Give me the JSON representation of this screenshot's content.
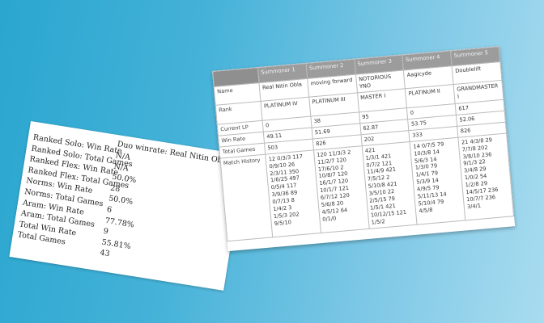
{
  "stats": {
    "duo": "Duo winrate: Real Nitin Obla",
    "rows": [
      {
        "label": "Ranked Solo: Win Rate",
        "value": "N/A"
      },
      {
        "label": "Ranked Solo: Total Games",
        "value": "N/A"
      },
      {
        "label": "Ranked Flex: Win Rate",
        "value": "50.0%"
      },
      {
        "label": "Ranked Flex: Total Games",
        "value": "28"
      },
      {
        "label": "Norms: Win Rate",
        "value": "50.0%"
      },
      {
        "label": "Norms: Total Games",
        "value": "6"
      },
      {
        "label": "Aram: Win Rate",
        "value": "77.78%"
      },
      {
        "label": "Aram: Total Games",
        "value": "9"
      },
      {
        "label": "Total Win Rate",
        "value": "55.81%"
      },
      {
        "label": "Total Games",
        "value": "43"
      }
    ]
  },
  "table": {
    "headers": [
      "Summoner 1",
      "Summoner 2",
      "Summoner 3",
      "Summoner 4",
      "Summoner 5"
    ],
    "row_labels": {
      "name": "Name",
      "rank": "Rank",
      "lp": "Current LP",
      "winrate": "Win Rate",
      "games": "Total Games",
      "history": "Match History"
    },
    "summoners": [
      {
        "name": "Real Nitin Obla",
        "rank": "PLATINUM IV",
        "lp": "0",
        "winrate": "49.11",
        "games": "503",
        "history": [
          "12  0/3/3 117",
          "0/9/10 26",
          "2/3/11 350",
          "1/6/25 497",
          "0/5/4 117",
          "3/9/36 89",
          "0/7/13 8",
          "1/4/2 3",
          "1/5/3 202",
          "9/5/10"
        ]
      },
      {
        "name": "moving forward",
        "rank": "PLATINUM III",
        "lp": "38",
        "winrate": "51.69",
        "games": "826",
        "history": [
          "120  11/3/3 2",
          "11/2/7 120",
          "17/6/10 2",
          "10/8/7 120",
          "16/1/7 120",
          "10/1/7 121",
          "6/7/12 120",
          "5/6/8 20",
          "4/5/12 64",
          "0/1/0"
        ]
      },
      {
        "name": "NOTORIOUS YNO",
        "rank": "MASTER I",
        "lp": "95",
        "winrate": "62.87",
        "games": "202",
        "history": [
          "421",
          "1/3/1 421",
          "0/7/2 121",
          "11/4/9 421",
          "7/5/12 2",
          "5/10/8 421",
          "3/5/10 22",
          "2/5/15 79",
          "1/5/1 421",
          "10/12/15 121",
          "1/5/2"
        ]
      },
      {
        "name": "Aagicyde",
        "rank": "PLATINUM II",
        "lp": "0",
        "winrate": "53.75",
        "games": "333",
        "history": [
          "14  0/7/5 79",
          "10/3/8 14",
          "5/6/3 14",
          "1/3/0 79",
          "1/4/1 79",
          "5/3/9 14",
          "4/9/5 79",
          "5/11/13 14",
          "5/10/4 79",
          "4/5/8"
        ]
      },
      {
        "name": "Doublelift",
        "rank": "GRANDMASTER I",
        "lp": "617",
        "winrate": "52.06",
        "games": "826",
        "history": [
          "21  4/3/8 29",
          "7/7/8 202",
          "3/8/10 236",
          "9/1/3 22",
          "3/4/8 29",
          "1/0/2 54",
          "1/2/8 29",
          "14/5/17 236",
          "10/7/7 236",
          "3/4/1"
        ]
      }
    ]
  }
}
